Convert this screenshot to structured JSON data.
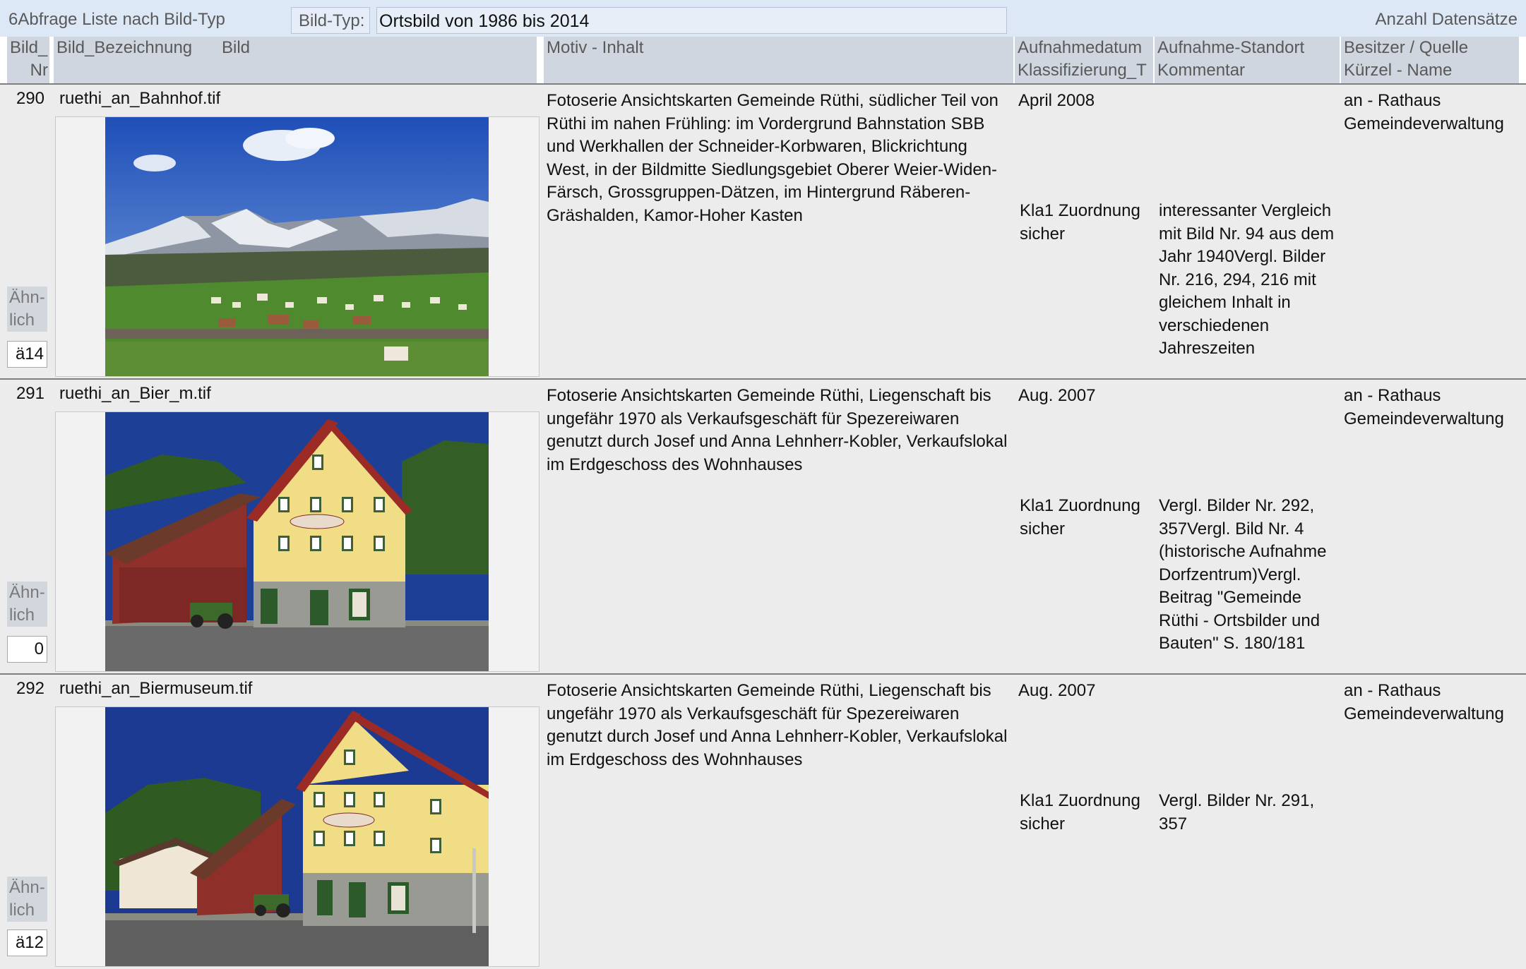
{
  "header": {
    "title": "6Abfrage Liste nach Bild-Typ",
    "filter_label": "Bild-Typ:",
    "filter_value": "Ortsbild von 1986 bis 2014",
    "record_count_label": "Anzahl Datensätze"
  },
  "columns": {
    "nr_line1": "Bild_",
    "nr_line2": "Nr",
    "bezeichnung": "Bild_Bezeichnung",
    "bild": "Bild",
    "motiv": "Motiv - Inhalt",
    "datum_line1": "Aufnahmedatum",
    "datum_line2": "Klassifizierung_T",
    "standort_line1": "Aufnahme-Standort",
    "standort_line2": "Kommentar",
    "besitzer_line1": "Besitzer / Quelle",
    "besitzer_line2": "Kürzel - Name"
  },
  "similar_label_line1": "Ähn-",
  "similar_label_line2": "lich",
  "rows": [
    {
      "nr": "290",
      "file": "ruethi_an_Bahnhof.tif",
      "photo": "mountain-village-photo",
      "motiv": "Fotoserie Ansichtskarten Gemeinde Rüthi, südlicher Teil von Rüthi im nahen Frühling: im Vordergrund Bahnstation SBB und Werkhallen der Schneider-Korbwaren, Blickrichtung West,  in der Bildmitte Siedlungsgebiet Oberer Weier-Widen-Färsch, Grossgruppen-Dätzen, im Hintergrund Räberen-Gräshalden, Kamor-Hoher Kasten",
      "datum": "April 2008",
      "klass": "Kla1 Zuordnung sicher",
      "kommentar": "interessanter Vergleich mit Bild Nr. 94 aus dem Jahr 1940Vergl. Bilder Nr. 216, 294, 216 mit gleichem Inhalt in verschiedenen Jahreszeiten",
      "besitzer": "an - Rathaus Gemeindeverwaltung",
      "similar": "ä14"
    },
    {
      "nr": "291",
      "file": "ruethi_an_Bier_m.tif",
      "photo": "beer-museum-house-photo",
      "motiv": "Fotoserie Ansichtskarten Gemeinde Rüthi, Liegenschaft bis ungefähr 1970 als Verkaufsgeschäft für Spezereiwaren genutzt  durch Josef und Anna Lehnherr-Kobler, Verkaufslokal im Erdgeschoss des Wohnhauses",
      "datum": "Aug. 2007",
      "klass": "Kla1 Zuordnung sicher",
      "kommentar": "Vergl. Bilder Nr. 292, 357Vergl. Bild Nr. 4 (historische Aufnahme Dorfzentrum)Vergl. Beitrag \"Gemeinde Rüthi - Ortsbilder und Bauten\" S. 180/181",
      "besitzer": "an - Rathaus Gemeindeverwaltung",
      "similar": "0"
    },
    {
      "nr": "292",
      "file": "ruethi_an_Biermuseum.tif",
      "photo": "beer-museum-street-photo",
      "motiv": "Fotoserie Ansichtskarten Gemeinde Rüthi, Liegenschaft bis ungefähr 1970 als Verkaufsgeschäft für Spezereiwaren genutzt  durch Josef und Anna Lehnherr-Kobler, Verkaufslokal im Erdgeschoss des Wohnhauses",
      "datum": "Aug. 2007",
      "klass": "Kla1 Zuordnung sicher",
      "kommentar": "Vergl. Bilder Nr. 291, 357",
      "besitzer": "an - Rathaus Gemeindeverwaltung",
      "similar": "ä12"
    }
  ]
}
